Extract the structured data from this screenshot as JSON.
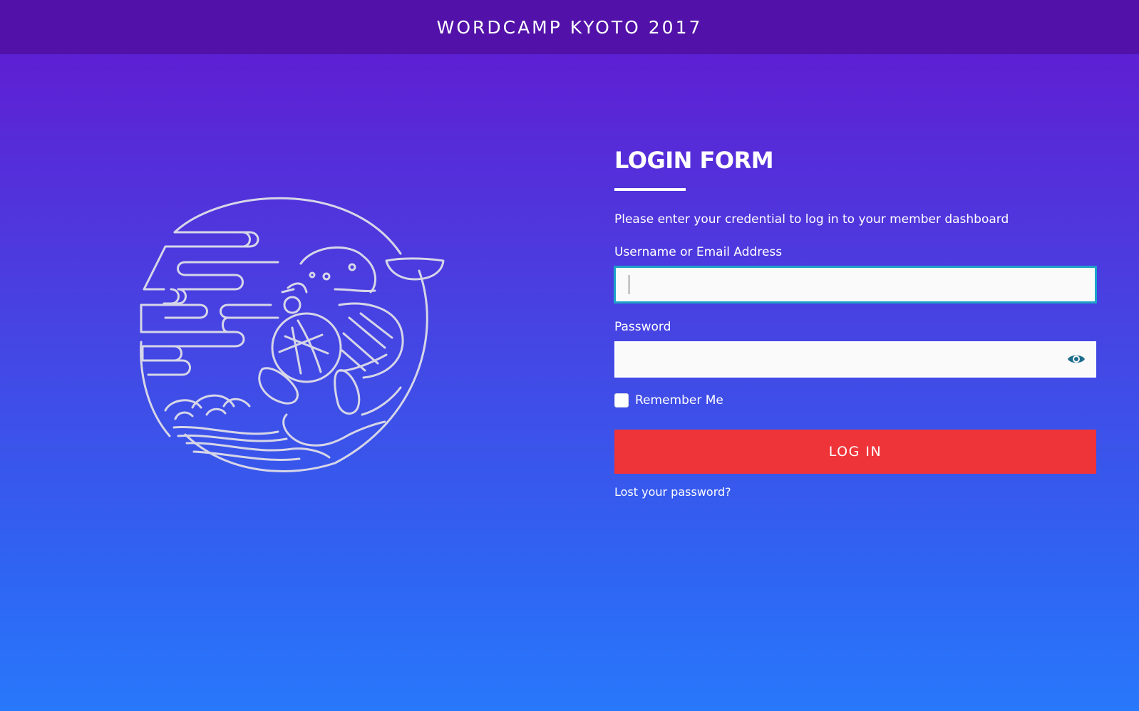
{
  "header": {
    "site_title": "WORDCAMP KYOTO 2017"
  },
  "illustration": {
    "icon": "wapuu-kyoto-illustration",
    "stroke_color": "#d6d6e8"
  },
  "login": {
    "title": "LOGIN FORM",
    "intro": "Please enter your credential to log in to your member dashboard",
    "username_label": "Username or Email Address",
    "username_value": "",
    "password_label": "Password",
    "password_value": "",
    "remember_label": "Remember Me",
    "remember_checked": false,
    "submit_label": "LOG IN",
    "lost_password_label": "Lost your password?"
  },
  "colors": {
    "header_bg": "#5211a8",
    "gradient_top": "#6318d0",
    "gradient_bottom": "#2878fb",
    "button": "#ef3439",
    "focus_border": "#1da1c8",
    "eye_icon": "#1d6d8c"
  }
}
